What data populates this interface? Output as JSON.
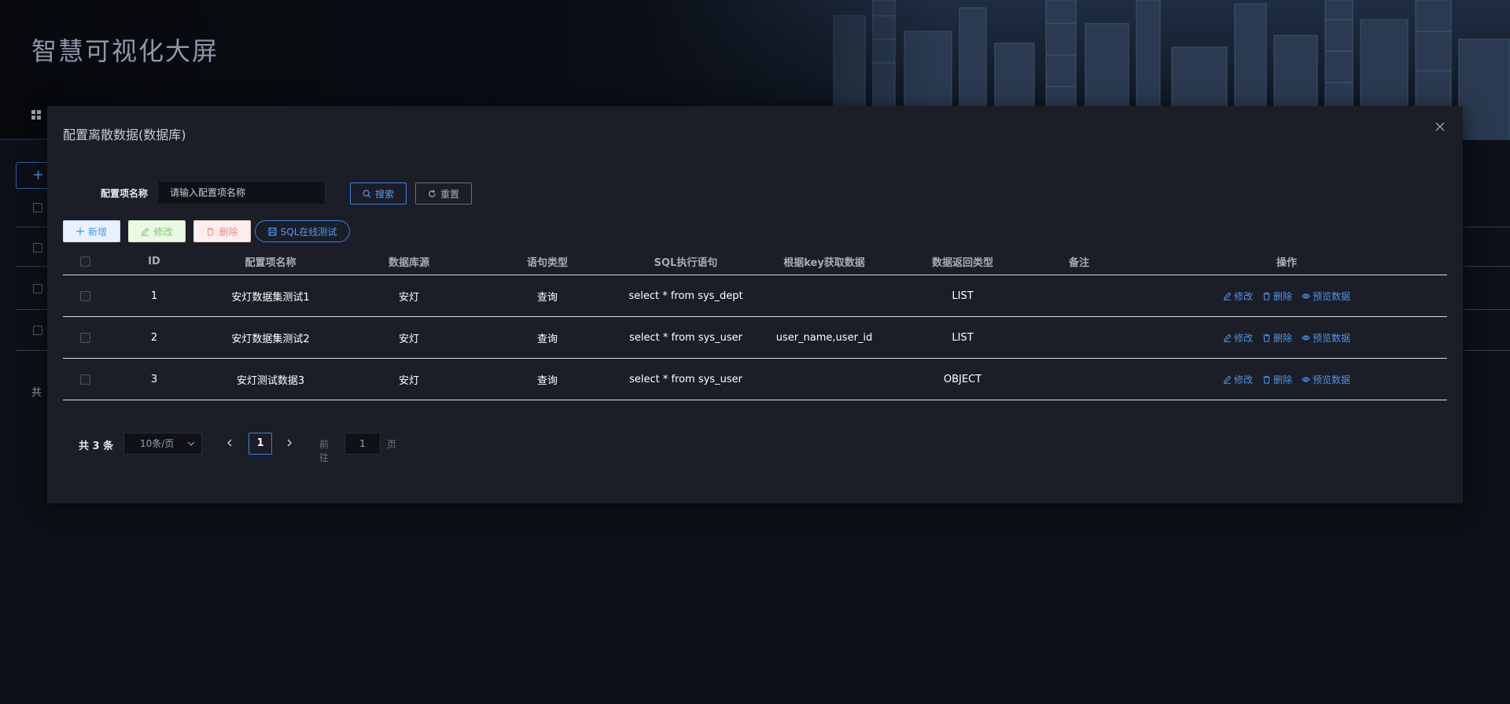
{
  "app": {
    "title": "智慧可视化大屏"
  },
  "background": {
    "total_prefix": "共"
  },
  "modal": {
    "title": "配置离散数据(数据库)",
    "close_icon": "close-icon"
  },
  "search": {
    "label": "配置项名称",
    "placeholder": "请输入配置项名称",
    "search_label": "搜索",
    "reset_label": "重置"
  },
  "toolbar": {
    "add_label": "新增",
    "edit_label": "修改",
    "delete_label": "删除",
    "sql_label": "SQL在线测试"
  },
  "table": {
    "headers": {
      "id": "ID",
      "name": "配置项名称",
      "source": "数据库源",
      "stmt_type": "语句类型",
      "sql": "SQL执行语句",
      "key": "根据key获取数据",
      "return_type": "数据返回类型",
      "note": "备注",
      "ops": "操作"
    },
    "rows": [
      {
        "id": "1",
        "name": "安灯数据集测试1",
        "source": "安灯",
        "stmt_type": "查询",
        "sql": "select * from sys_dept",
        "key": "",
        "return_type": "LIST",
        "note": ""
      },
      {
        "id": "2",
        "name": "安灯数据集测试2",
        "source": "安灯",
        "stmt_type": "查询",
        "sql": "select * from sys_user",
        "key": "user_name,user_id",
        "return_type": "LIST",
        "note": ""
      },
      {
        "id": "3",
        "name": "安灯测试数据3",
        "source": "安灯",
        "stmt_type": "查询",
        "sql": "select * from sys_user",
        "key": "",
        "return_type": "OBJECT",
        "note": ""
      }
    ],
    "ops": {
      "edit": "修改",
      "delete": "删除",
      "preview": "预览数据"
    }
  },
  "pagination": {
    "total": "共 3 条",
    "page_size": "10条/页",
    "current_page": "1",
    "goto_prefix": "前往",
    "goto_value": "1",
    "goto_suffix": "页"
  },
  "colors": {
    "accent": "#4f93ee",
    "modal_bg": "#1b1e26",
    "page_bg": "#0d1016"
  }
}
